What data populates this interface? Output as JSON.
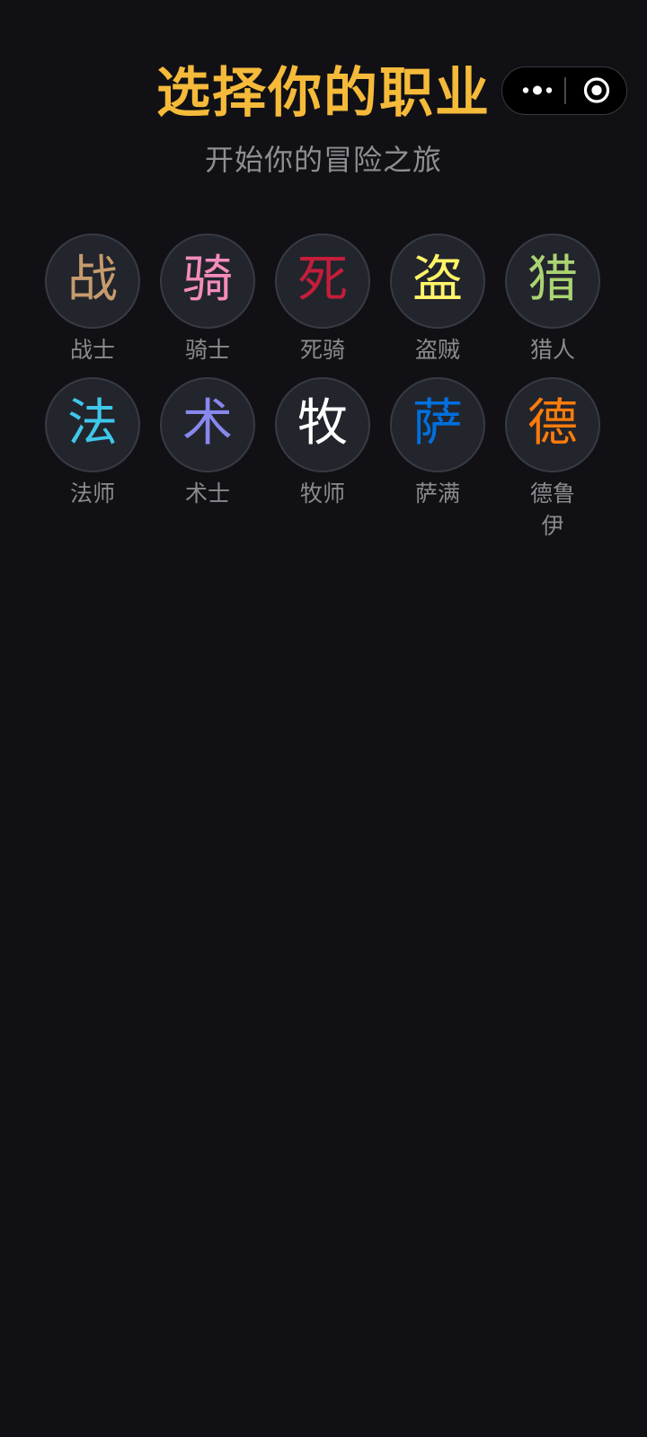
{
  "header": {
    "title": "选择你的职业",
    "subtitle": "开始你的冒险之旅"
  },
  "capsule": {
    "more_icon": "more-dots-icon",
    "close_icon": "target-close-icon"
  },
  "classes": [
    {
      "glyph": "战",
      "label": "战士",
      "color": "#C69B6D"
    },
    {
      "glyph": "骑",
      "label": "骑士",
      "color": "#F48CBA"
    },
    {
      "glyph": "死",
      "label": "死骑",
      "color": "#C41E3A"
    },
    {
      "glyph": "盗",
      "label": "盗贼",
      "color": "#FFF468"
    },
    {
      "glyph": "猎",
      "label": "猎人",
      "color": "#AAD372"
    },
    {
      "glyph": "法",
      "label": "法师",
      "color": "#3FC7EB"
    },
    {
      "glyph": "术",
      "label": "术士",
      "color": "#8788EE"
    },
    {
      "glyph": "牧",
      "label": "牧师",
      "color": "#FFFFFF"
    },
    {
      "glyph": "萨",
      "label": "萨满",
      "color": "#0070DD"
    },
    {
      "glyph": "德",
      "label": "德鲁伊",
      "color": "#FF7C0A"
    }
  ]
}
